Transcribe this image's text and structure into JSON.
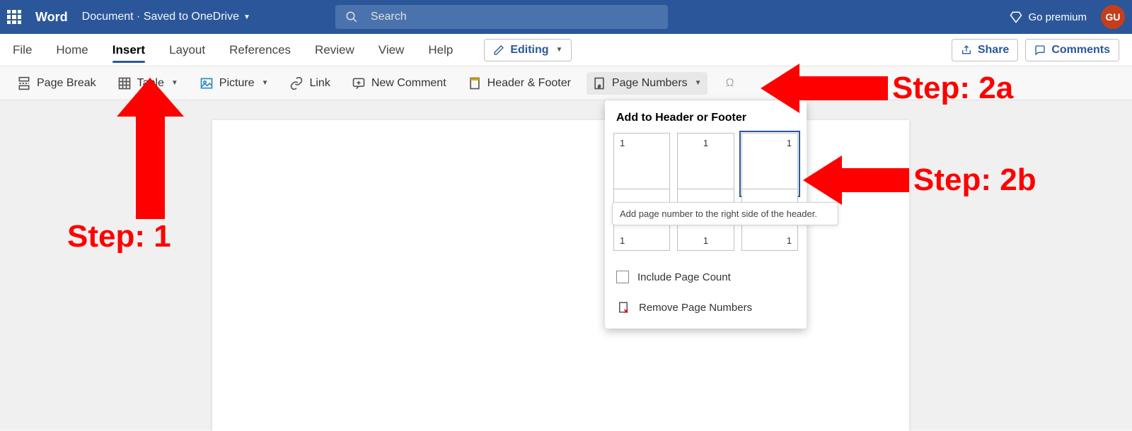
{
  "title_bar": {
    "app_name": "Word",
    "doc_title": "Document  ·  Saved to OneDrive",
    "search_placeholder": "Search",
    "go_premium": "Go premium",
    "avatar_initials": "GU"
  },
  "tabs": {
    "file": "File",
    "home": "Home",
    "insert": "Insert",
    "layout": "Layout",
    "references": "References",
    "review": "Review",
    "view": "View",
    "help": "Help",
    "editing": "Editing",
    "share": "Share",
    "comments": "Comments"
  },
  "ribbon": {
    "page_break": "Page Break",
    "table": "Table",
    "picture": "Picture",
    "link": "Link",
    "new_comment": "New Comment",
    "header_footer": "Header & Footer",
    "page_numbers": "Page Numbers"
  },
  "dropdown": {
    "heading": "Add to Header or Footer",
    "tile_number": "1",
    "tooltip": "Add page number to the right side of the header.",
    "include_page_count": "Include Page Count",
    "remove": "Remove Page Numbers"
  },
  "annotations": {
    "step1": "Step: 1",
    "step2a": "Step: 2a",
    "step2b": "Step: 2b"
  }
}
